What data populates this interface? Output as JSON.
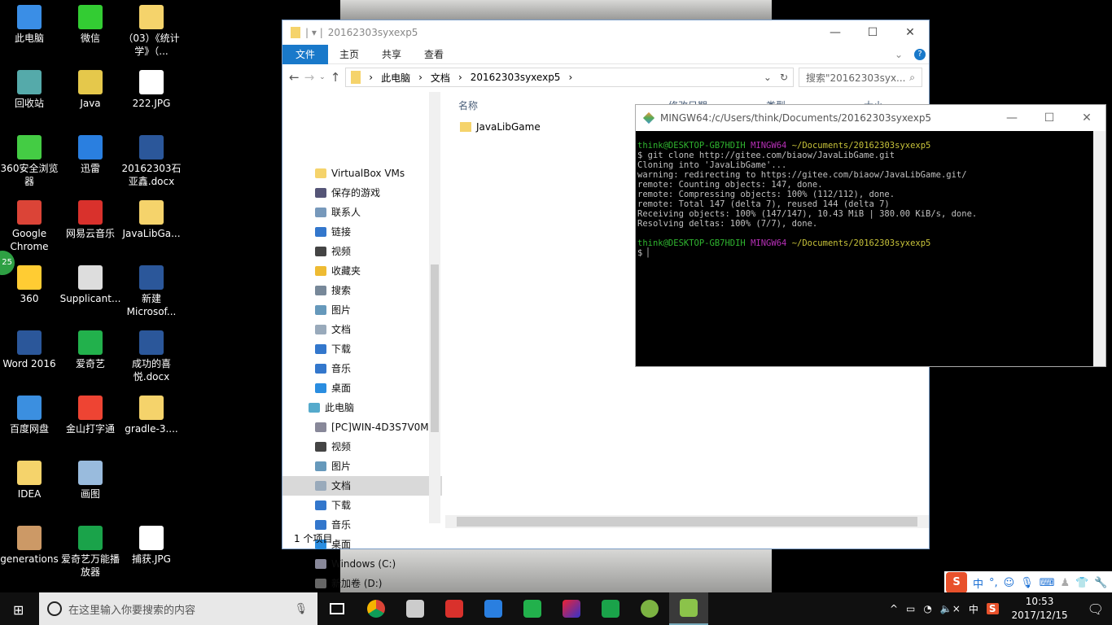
{
  "desktop": {
    "icons": [
      [
        "此电脑",
        "回收站",
        "360安全浏览器",
        "Google Chrome",
        "360",
        "Word 2016",
        "百度网盘",
        "IDEA",
        "generations"
      ],
      [
        "微信",
        "Java",
        "迅雷",
        "网易云音乐",
        "Supplicant...",
        "爱奇艺",
        "金山打字通",
        "画图",
        "爱奇艺万能播放器"
      ],
      [
        "（03）《统计学》（...",
        "222.JPG",
        "20162303石亚鑫.docx",
        "JavaLibGa...",
        "新建 Microsof...",
        "成功的喜悦.docx",
        "gradle-3....",
        "",
        "捕获.JPG"
      ]
    ],
    "badge": "25"
  },
  "explorer": {
    "title": "20162303syxexp5",
    "ribbon": [
      "文件",
      "主页",
      "共享",
      "查看"
    ],
    "breadcrumb": [
      "此电脑",
      "文档",
      "20162303syxexp5"
    ],
    "search_placeholder": "搜索\"20162303syx...",
    "nav": [
      "VirtualBox VMs",
      "保存的游戏",
      "联系人",
      "链接",
      "视频",
      "收藏夹",
      "搜索",
      "图片",
      "文档",
      "下载",
      "音乐",
      "桌面",
      "此电脑",
      "[PC]WIN-4D3S7V0M",
      "视频",
      "图片",
      "文档",
      "下载",
      "音乐",
      "桌面",
      "Windows (C:)",
      "新加卷 (D:)"
    ],
    "columns": [
      "名称",
      "修改日期",
      "类型",
      "大小"
    ],
    "files": [
      "JavaLibGame"
    ],
    "status": "1 个项目"
  },
  "terminal": {
    "title": "MINGW64:/c/Users/think/Documents/20162303syxexp5",
    "user": "think@DESKTOP-GB7HDIH",
    "env": "MINGW64",
    "path": "~/Documents/20162303syxexp5",
    "lines": [
      "$ git clone http://gitee.com/biaow/JavaLibGame.git",
      "Cloning into 'JavaLibGame'...",
      "warning: redirecting to https://gitee.com/biaow/JavaLibGame.git/",
      "remote: Counting objects: 147, done.",
      "remote: Compressing objects: 100% (112/112), done.",
      "remote: Total 147 (delta 7), reused 144 (delta 7)",
      "Receiving objects: 100% (147/147), 10.43 MiB | 380.00 KiB/s, done.",
      "Resolving deltas: 100% (7/7), done."
    ],
    "prompt": "$"
  },
  "taskbar": {
    "search_placeholder": "在这里输入你要搜索的内容",
    "time": "10:53",
    "date": "2017/12/15",
    "ime": "中"
  },
  "ime_bar": {
    "mode": "中",
    "punct": "°,"
  }
}
